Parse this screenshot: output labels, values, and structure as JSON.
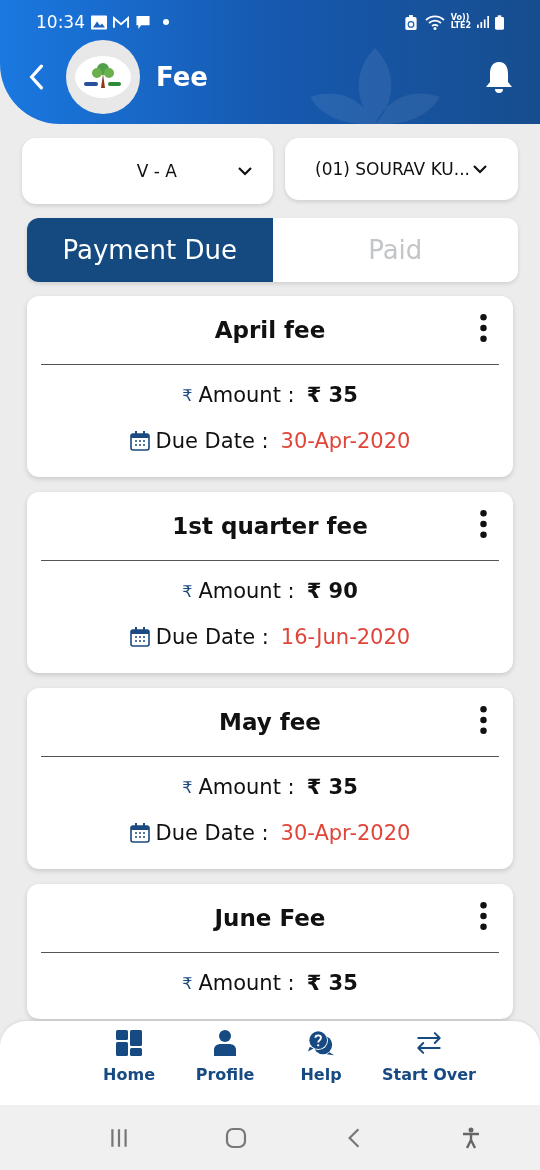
{
  "status_bar": {
    "time": "10:34",
    "network_top": "Vo))",
    "network_bottom": "LTE2"
  },
  "header": {
    "title": "Fee"
  },
  "selectors": [
    {
      "value": "V - A"
    },
    {
      "value": "(01) SOURAV KU..."
    }
  ],
  "tabs": [
    {
      "label": "Payment Due",
      "selected": true
    },
    {
      "label": "Paid",
      "selected": false
    }
  ],
  "currency_symbol": "₹",
  "fees": [
    {
      "title": "April fee",
      "amount_label": "Amount :",
      "amount": "₹ 35",
      "due_label": "Due Date :",
      "due_date": "30-Apr-2020"
    },
    {
      "title": "1st quarter fee",
      "amount_label": "Amount :",
      "amount": "₹ 90",
      "due_label": "Due Date :",
      "due_date": "16-Jun-2020"
    },
    {
      "title": "May fee",
      "amount_label": "Amount :",
      "amount": "₹ 35",
      "due_label": "Due Date :",
      "due_date": "30-Apr-2020"
    },
    {
      "title": "June Fee",
      "amount_label": "Amount :",
      "amount": "₹ 35"
    }
  ],
  "bottom_nav": [
    {
      "kind": "home",
      "label": "Home"
    },
    {
      "kind": "profile",
      "label": "Profile"
    },
    {
      "kind": "help",
      "label": "Help"
    },
    {
      "kind": "swap",
      "label": "Start Over"
    }
  ]
}
